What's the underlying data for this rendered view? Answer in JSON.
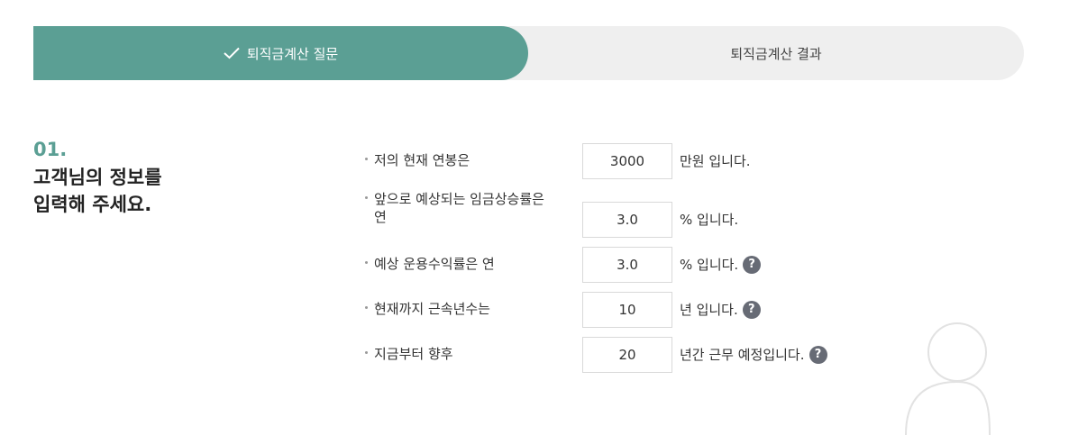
{
  "steps": {
    "active": {
      "label": "퇴직금계산 질문",
      "icon": "check-icon"
    },
    "inactive": {
      "label": "퇴직금계산 결과"
    }
  },
  "section": {
    "number": "01.",
    "title_line1": "고객님의 정보를",
    "title_line2": "입력해 주세요."
  },
  "questions": [
    {
      "label": "저의 현재 연봉은",
      "value": "3000",
      "unit": "만원 입니다.",
      "help": false
    },
    {
      "label_line1": "앞으로 예상되는 임금상승률은",
      "label_line2": "연",
      "value": "3.0",
      "unit": "% 입니다.",
      "help": false
    },
    {
      "label": "예상 운용수익률은 연",
      "value": "3.0",
      "unit": "% 입니다.",
      "help": true
    },
    {
      "label": "현재까지 근속년수는",
      "value": "10",
      "unit": "년 입니다.",
      "help": true
    },
    {
      "label": "지금부터 향후",
      "value": "20",
      "unit": "년간 근무 예정입니다.",
      "help": true
    }
  ],
  "help_glyph": "?",
  "colors": {
    "accent": "#5b9f94",
    "track": "#efefef",
    "help_bg": "#676b75"
  }
}
